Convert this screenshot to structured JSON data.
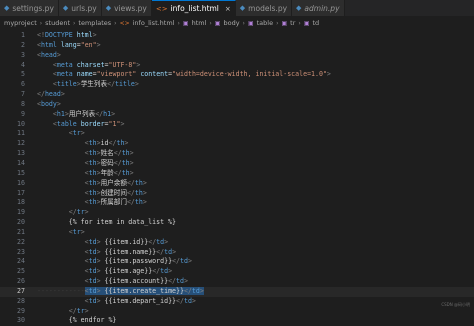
{
  "tabs": [
    {
      "label": "settings.py",
      "icon": "python-file-icon",
      "active": false,
      "italic": false
    },
    {
      "label": "urls.py",
      "icon": "python-file-icon",
      "active": false,
      "italic": false
    },
    {
      "label": "views.py",
      "icon": "python-file-icon",
      "active": false,
      "italic": false
    },
    {
      "label": "info_list.html",
      "icon": "html-file-icon",
      "active": true,
      "italic": false
    },
    {
      "label": "models.py",
      "icon": "python-file-icon",
      "active": false,
      "italic": false
    },
    {
      "label": "admin.py",
      "icon": "python-file-icon",
      "active": false,
      "italic": true
    }
  ],
  "breadcrumb": {
    "items": [
      "myproject",
      "student",
      "templates",
      "info_list.html",
      "html",
      "body",
      "table",
      "tr",
      "td"
    ]
  },
  "editor": {
    "current_line": 27,
    "lines": [
      {
        "n": "1",
        "html": "<span class=\"punc\">&lt;!</span><span class=\"tag\">DOCTYPE</span> <span class=\"attr\">html</span><span class=\"punc\">&gt;</span>"
      },
      {
        "n": "2",
        "html": "<span class=\"punc\">&lt;</span><span class=\"tag\">html</span> <span class=\"attr\">lang</span><span class=\"txt\">=</span><span class=\"str\">\"en\"</span><span class=\"punc\">&gt;</span>"
      },
      {
        "n": "3",
        "html": "<span class=\"punc\">&lt;</span><span class=\"tag\">head</span><span class=\"punc\">&gt;</span>"
      },
      {
        "n": "4",
        "html": "<span class=\"ind\">    </span><span class=\"punc\">&lt;</span><span class=\"tag\">meta</span> <span class=\"attr\">charset</span><span class=\"txt\">=</span><span class=\"str\">\"UTF-8\"</span><span class=\"punc\">&gt;</span>"
      },
      {
        "n": "5",
        "html": "<span class=\"ind\">    </span><span class=\"punc\">&lt;</span><span class=\"tag\">meta</span> <span class=\"attr\">name</span><span class=\"txt\">=</span><span class=\"str\">\"viewport\"</span> <span class=\"attr\">content</span><span class=\"txt\">=</span><span class=\"str\">\"width=device-width, initial-scale=1.0\"</span><span class=\"punc\">&gt;</span>"
      },
      {
        "n": "6",
        "html": "<span class=\"ind\">    </span><span class=\"punc\">&lt;</span><span class=\"tag\">title</span><span class=\"punc\">&gt;</span><span class=\"txt\">学生列表</span><span class=\"punc\">&lt;/</span><span class=\"tag\">title</span><span class=\"punc\">&gt;</span>"
      },
      {
        "n": "7",
        "html": "<span class=\"punc\">&lt;/</span><span class=\"tag\">head</span><span class=\"punc\">&gt;</span>"
      },
      {
        "n": "8",
        "html": "<span class=\"punc\">&lt;</span><span class=\"tag\">body</span><span class=\"punc\">&gt;</span>"
      },
      {
        "n": "9",
        "html": "<span class=\"ind\">    </span><span class=\"punc\">&lt;</span><span class=\"tag\">h1</span><span class=\"punc\">&gt;</span><span class=\"txt\">用户列表</span><span class=\"punc\">&lt;/</span><span class=\"tag\">h1</span><span class=\"punc\">&gt;</span>"
      },
      {
        "n": "10",
        "html": "<span class=\"ind\">    </span><span class=\"punc\">&lt;</span><span class=\"tag\">table</span> <span class=\"attr\">border</span><span class=\"txt\">=</span><span class=\"str\">\"1\"</span><span class=\"punc\">&gt;</span>"
      },
      {
        "n": "11",
        "html": "<span class=\"ind\">        </span><span class=\"punc\">&lt;</span><span class=\"tag\">tr</span><span class=\"punc\">&gt;</span>"
      },
      {
        "n": "12",
        "html": "<span class=\"ind\">            </span><span class=\"punc\">&lt;</span><span class=\"tag\">th</span><span class=\"punc\">&gt;</span><span class=\"txt\">id</span><span class=\"punc\">&lt;/</span><span class=\"tag\">th</span><span class=\"punc\">&gt;</span>"
      },
      {
        "n": "13",
        "html": "<span class=\"ind\">            </span><span class=\"punc\">&lt;</span><span class=\"tag\">th</span><span class=\"punc\">&gt;</span><span class=\"txt\">姓名</span><span class=\"punc\">&lt;/</span><span class=\"tag\">th</span><span class=\"punc\">&gt;</span>"
      },
      {
        "n": "14",
        "html": "<span class=\"ind\">            </span><span class=\"punc\">&lt;</span><span class=\"tag\">th</span><span class=\"punc\">&gt;</span><span class=\"txt\">密码</span><span class=\"punc\">&lt;/</span><span class=\"tag\">th</span><span class=\"punc\">&gt;</span>"
      },
      {
        "n": "15",
        "html": "<span class=\"ind\">            </span><span class=\"punc\">&lt;</span><span class=\"tag\">th</span><span class=\"punc\">&gt;</span><span class=\"txt\">年龄</span><span class=\"punc\">&lt;/</span><span class=\"tag\">th</span><span class=\"punc\">&gt;</span>"
      },
      {
        "n": "16",
        "html": "<span class=\"ind\">            </span><span class=\"punc\">&lt;</span><span class=\"tag\">th</span><span class=\"punc\">&gt;</span><span class=\"txt\">用户余额</span><span class=\"punc\">&lt;/</span><span class=\"tag\">th</span><span class=\"punc\">&gt;</span>"
      },
      {
        "n": "17",
        "html": "<span class=\"ind\">            </span><span class=\"punc\">&lt;</span><span class=\"tag\">th</span><span class=\"punc\">&gt;</span><span class=\"txt\">创建时间</span><span class=\"punc\">&lt;/</span><span class=\"tag\">th</span><span class=\"punc\">&gt;</span>"
      },
      {
        "n": "18",
        "html": "<span class=\"ind\">            </span><span class=\"punc\">&lt;</span><span class=\"tag\">th</span><span class=\"punc\">&gt;</span><span class=\"txt\">所属部门</span><span class=\"punc\">&lt;/</span><span class=\"tag\">th</span><span class=\"punc\">&gt;</span>"
      },
      {
        "n": "19",
        "html": "<span class=\"ind\">        </span><span class=\"punc\">&lt;/</span><span class=\"tag\">tr</span><span class=\"punc\">&gt;</span>"
      },
      {
        "n": "20",
        "html": "<span class=\"ind\">        </span><span class=\"tmpl\">{% for item in data_list %}</span>"
      },
      {
        "n": "21",
        "html": "<span class=\"ind\">        </span><span class=\"punc\">&lt;</span><span class=\"tag\">tr</span><span class=\"punc\">&gt;</span>"
      },
      {
        "n": "22",
        "html": "<span class=\"ind\">            </span><span class=\"punc\">&lt;</span><span class=\"tag\">td</span><span class=\"punc\">&gt;</span> <span class=\"tmpl\">{{item.id}}</span><span class=\"punc\">&lt;/</span><span class=\"tag\">td</span><span class=\"punc\">&gt;</span>"
      },
      {
        "n": "23",
        "html": "<span class=\"ind\">            </span><span class=\"punc\">&lt;</span><span class=\"tag\">td</span><span class=\"punc\">&gt;</span> <span class=\"tmpl\">{{item.name}}</span><span class=\"punc\">&lt;/</span><span class=\"tag\">td</span><span class=\"punc\">&gt;</span>"
      },
      {
        "n": "24",
        "html": "<span class=\"ind\">            </span><span class=\"punc\">&lt;</span><span class=\"tag\">td</span><span class=\"punc\">&gt;</span> <span class=\"tmpl\">{{item.password}}</span><span class=\"punc\">&lt;/</span><span class=\"tag\">td</span><span class=\"punc\">&gt;</span>"
      },
      {
        "n": "25",
        "html": "<span class=\"ind\">            </span><span class=\"punc\">&lt;</span><span class=\"tag\">td</span><span class=\"punc\">&gt;</span> <span class=\"tmpl\">{{item.age}}</span><span class=\"punc\">&lt;/</span><span class=\"tag\">td</span><span class=\"punc\">&gt;</span>"
      },
      {
        "n": "26",
        "html": "<span class=\"ind\">            </span><span class=\"punc\">&lt;</span><span class=\"tag\">td</span><span class=\"punc\">&gt;</span> <span class=\"tmpl\">{{item.account}}</span><span class=\"punc\">&lt;/</span><span class=\"tag\">td</span><span class=\"punc\">&gt;</span>"
      },
      {
        "n": "27",
        "html": "<span class=\"dash\">------------</span><span class=\"sel\"><span class=\"punc\">&lt;</span><span class=\"tag\">td</span><span class=\"punc\">&gt;</span> <span class=\"tmpl\">{{item.create_time}}</span><span class=\"punc\">&lt;/</span><span class=\"tag\">td</span><span class=\"punc\">&gt;</span></span>"
      },
      {
        "n": "28",
        "html": "<span class=\"ind\">            </span><span class=\"punc\">&lt;</span><span class=\"tag\">td</span><span class=\"punc\">&gt;</span> <span class=\"tmpl\">{{item.depart_id}}</span><span class=\"punc\">&lt;/</span><span class=\"tag\">td</span><span class=\"punc\">&gt;</span>"
      },
      {
        "n": "29",
        "html": "<span class=\"ind\">        </span><span class=\"punc\">&lt;/</span><span class=\"tag\">tr</span><span class=\"punc\">&gt;</span>"
      },
      {
        "n": "30",
        "html": "<span class=\"ind\">        </span><span class=\"tmpl\">{% endfor %}</span>"
      }
    ]
  },
  "watermark": "CSDN @码小明"
}
